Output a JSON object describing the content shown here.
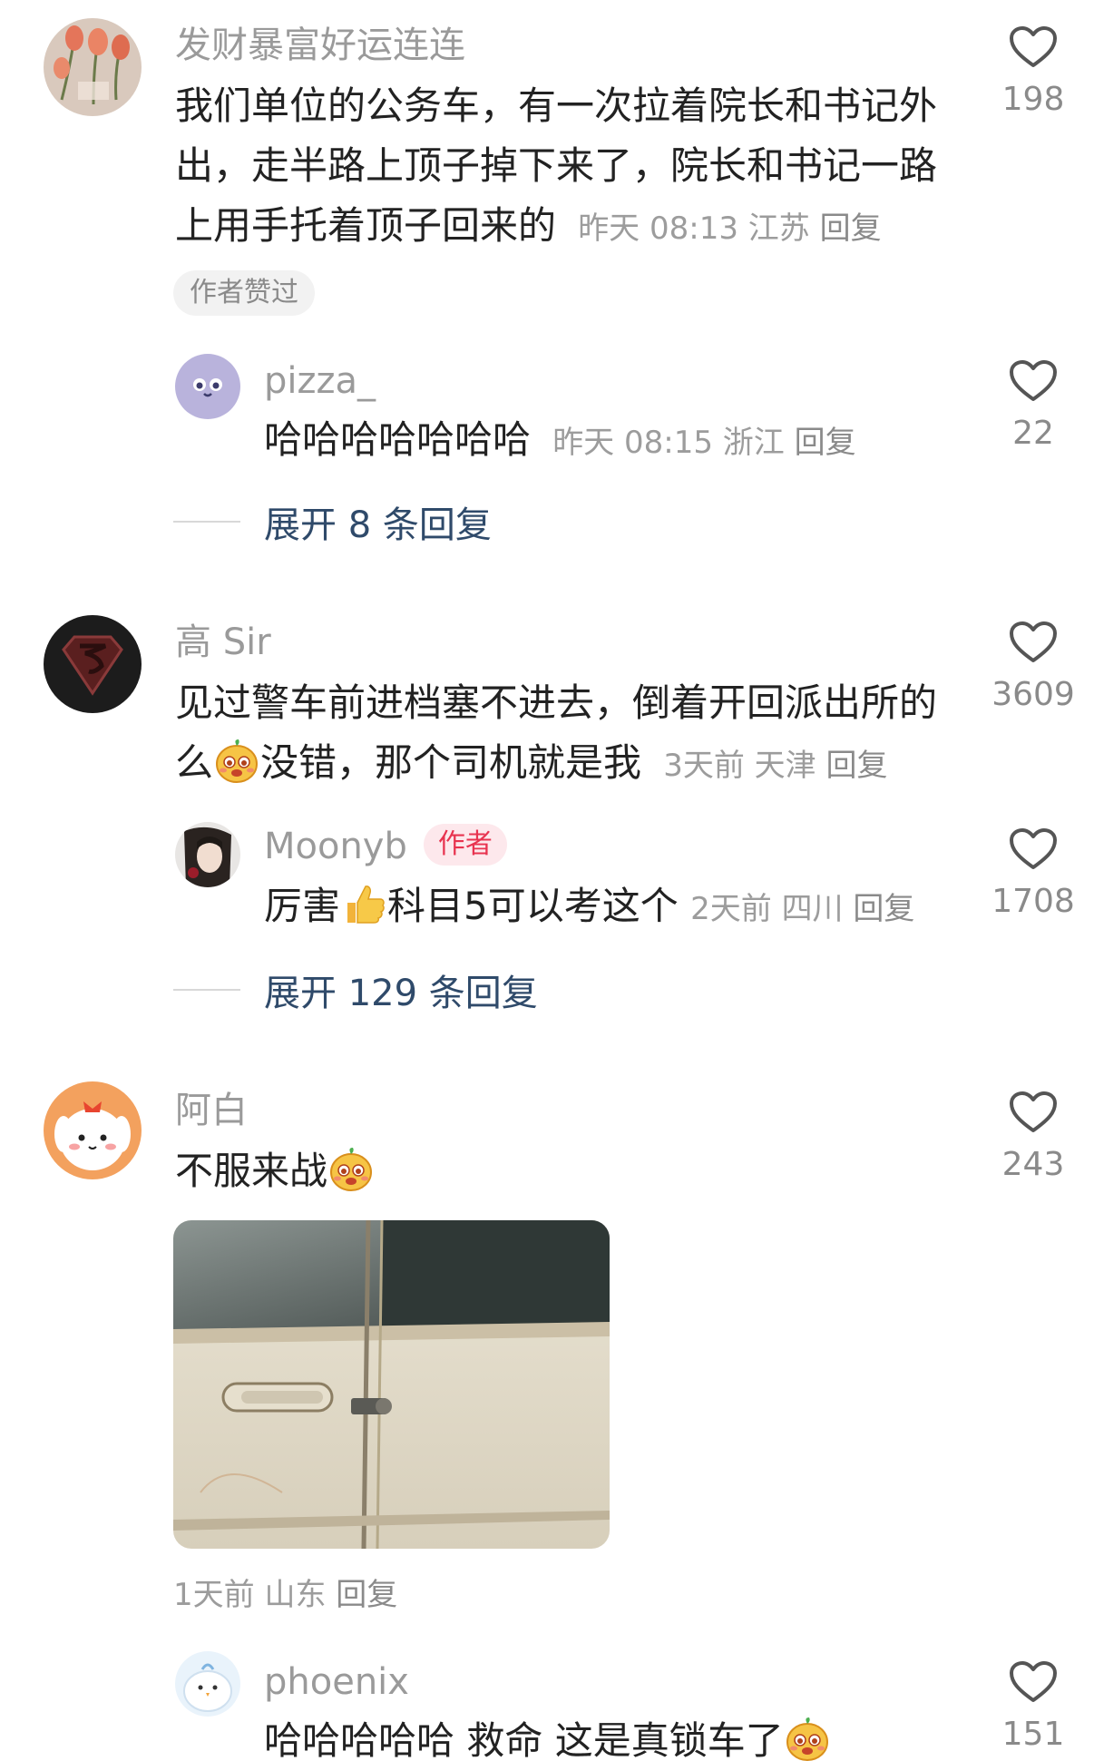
{
  "comments": [
    {
      "user": "发财暴富好运连连",
      "text": "我们单位的公务车，有一次拉着院长和书记外出，走半路上顶子掉下来了，院长和书记一路上用手托着顶子回来的",
      "time": "昨天 08:13",
      "region": "江苏",
      "reply_label": "回复",
      "likes": "198",
      "liked_by_author": "作者赞过",
      "replies": [
        {
          "user": "pizza_",
          "text": "哈哈哈哈哈哈哈",
          "time": "昨天 08:15",
          "region": "浙江",
          "reply_label": "回复",
          "likes": "22"
        }
      ],
      "expand_label": "展开 8 条回复"
    },
    {
      "user": "高 Sir",
      "text_line1": "见过警车前进档塞不进去，倒着开回派出所的",
      "text_line2_pre": "么",
      "text_line2_post": "没错，那个司机就是我",
      "time": "3天前",
      "region": "天津",
      "reply_label": "回复",
      "likes": "3609",
      "replies": [
        {
          "user": "Moonyb",
          "badge": "作者",
          "text_pre": "厉害",
          "text_post": "科目5可以考这个",
          "time": "2天前",
          "region": "四川",
          "reply_label": "回复",
          "likes": "1708"
        }
      ],
      "expand_label": "展开 129 条回复"
    },
    {
      "user": "阿白",
      "text": "不服来战",
      "time": "1天前",
      "region": "山东",
      "reply_label": "回复",
      "likes": "243",
      "replies": [
        {
          "user": "phoenix",
          "text": "哈哈哈哈哈 救命 这是真锁车了",
          "likes": "151"
        }
      ]
    }
  ],
  "icons": {
    "like": "heart-outline-icon",
    "emoji_face": "yellow-face-emoji",
    "thumbs_up": "thumbs-up-emoji"
  },
  "colors": {
    "expand_link": "#2f4a6a",
    "author_badge": "#e8334f",
    "meta_gray": "#9c9c9c"
  }
}
